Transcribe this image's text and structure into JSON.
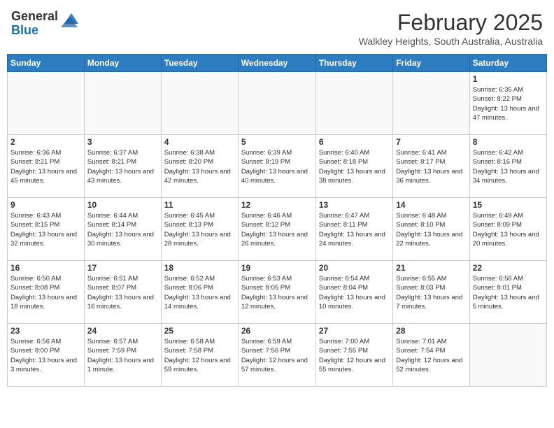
{
  "header": {
    "logo_general": "General",
    "logo_blue": "Blue",
    "month_title": "February 2025",
    "location": "Walkley Heights, South Australia, Australia"
  },
  "weekdays": [
    "Sunday",
    "Monday",
    "Tuesday",
    "Wednesday",
    "Thursday",
    "Friday",
    "Saturday"
  ],
  "weeks": [
    [
      {
        "day": "",
        "info": ""
      },
      {
        "day": "",
        "info": ""
      },
      {
        "day": "",
        "info": ""
      },
      {
        "day": "",
        "info": ""
      },
      {
        "day": "",
        "info": ""
      },
      {
        "day": "",
        "info": ""
      },
      {
        "day": "1",
        "info": "Sunrise: 6:35 AM\nSunset: 8:22 PM\nDaylight: 13 hours and 47 minutes."
      }
    ],
    [
      {
        "day": "2",
        "info": "Sunrise: 6:36 AM\nSunset: 8:21 PM\nDaylight: 13 hours and 45 minutes."
      },
      {
        "day": "3",
        "info": "Sunrise: 6:37 AM\nSunset: 8:21 PM\nDaylight: 13 hours and 43 minutes."
      },
      {
        "day": "4",
        "info": "Sunrise: 6:38 AM\nSunset: 8:20 PM\nDaylight: 13 hours and 42 minutes."
      },
      {
        "day": "5",
        "info": "Sunrise: 6:39 AM\nSunset: 8:19 PM\nDaylight: 13 hours and 40 minutes."
      },
      {
        "day": "6",
        "info": "Sunrise: 6:40 AM\nSunset: 8:18 PM\nDaylight: 13 hours and 38 minutes."
      },
      {
        "day": "7",
        "info": "Sunrise: 6:41 AM\nSunset: 8:17 PM\nDaylight: 13 hours and 36 minutes."
      },
      {
        "day": "8",
        "info": "Sunrise: 6:42 AM\nSunset: 8:16 PM\nDaylight: 13 hours and 34 minutes."
      }
    ],
    [
      {
        "day": "9",
        "info": "Sunrise: 6:43 AM\nSunset: 8:15 PM\nDaylight: 13 hours and 32 minutes."
      },
      {
        "day": "10",
        "info": "Sunrise: 6:44 AM\nSunset: 8:14 PM\nDaylight: 13 hours and 30 minutes."
      },
      {
        "day": "11",
        "info": "Sunrise: 6:45 AM\nSunset: 8:13 PM\nDaylight: 13 hours and 28 minutes."
      },
      {
        "day": "12",
        "info": "Sunrise: 6:46 AM\nSunset: 8:12 PM\nDaylight: 13 hours and 26 minutes."
      },
      {
        "day": "13",
        "info": "Sunrise: 6:47 AM\nSunset: 8:11 PM\nDaylight: 13 hours and 24 minutes."
      },
      {
        "day": "14",
        "info": "Sunrise: 6:48 AM\nSunset: 8:10 PM\nDaylight: 13 hours and 22 minutes."
      },
      {
        "day": "15",
        "info": "Sunrise: 6:49 AM\nSunset: 8:09 PM\nDaylight: 13 hours and 20 minutes."
      }
    ],
    [
      {
        "day": "16",
        "info": "Sunrise: 6:50 AM\nSunset: 8:08 PM\nDaylight: 13 hours and 18 minutes."
      },
      {
        "day": "17",
        "info": "Sunrise: 6:51 AM\nSunset: 8:07 PM\nDaylight: 13 hours and 16 minutes."
      },
      {
        "day": "18",
        "info": "Sunrise: 6:52 AM\nSunset: 8:06 PM\nDaylight: 13 hours and 14 minutes."
      },
      {
        "day": "19",
        "info": "Sunrise: 6:53 AM\nSunset: 8:05 PM\nDaylight: 13 hours and 12 minutes."
      },
      {
        "day": "20",
        "info": "Sunrise: 6:54 AM\nSunset: 8:04 PM\nDaylight: 13 hours and 10 minutes."
      },
      {
        "day": "21",
        "info": "Sunrise: 6:55 AM\nSunset: 8:03 PM\nDaylight: 13 hours and 7 minutes."
      },
      {
        "day": "22",
        "info": "Sunrise: 6:56 AM\nSunset: 8:01 PM\nDaylight: 13 hours and 5 minutes."
      }
    ],
    [
      {
        "day": "23",
        "info": "Sunrise: 6:56 AM\nSunset: 8:00 PM\nDaylight: 13 hours and 3 minutes."
      },
      {
        "day": "24",
        "info": "Sunrise: 6:57 AM\nSunset: 7:59 PM\nDaylight: 13 hours and 1 minute."
      },
      {
        "day": "25",
        "info": "Sunrise: 6:58 AM\nSunset: 7:58 PM\nDaylight: 12 hours and 59 minutes."
      },
      {
        "day": "26",
        "info": "Sunrise: 6:59 AM\nSunset: 7:56 PM\nDaylight: 12 hours and 57 minutes."
      },
      {
        "day": "27",
        "info": "Sunrise: 7:00 AM\nSunset: 7:55 PM\nDaylight: 12 hours and 55 minutes."
      },
      {
        "day": "28",
        "info": "Sunrise: 7:01 AM\nSunset: 7:54 PM\nDaylight: 12 hours and 52 minutes."
      },
      {
        "day": "",
        "info": ""
      }
    ]
  ]
}
